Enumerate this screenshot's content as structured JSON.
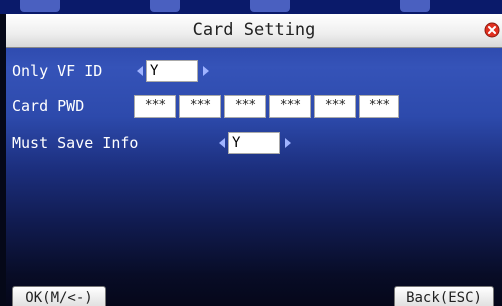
{
  "window": {
    "title": "Card Setting"
  },
  "settings": {
    "only_vf_id": {
      "label": "Only VF ID",
      "value": "Y"
    },
    "card_pwd": {
      "label": "Card PWD",
      "boxes": [
        "***",
        "***",
        "***",
        "***",
        "***",
        "***"
      ]
    },
    "must_save_info": {
      "label": "Must Save Info",
      "value": "Y"
    }
  },
  "softkeys": {
    "ok_label": "OK(M/<-)",
    "back_label": "Back(ESC)"
  },
  "colors": {
    "close_icon": "#e03020",
    "arrow": "#9fb3ff",
    "background_top": "#2a45a8",
    "background_bottom": "#05071a"
  }
}
